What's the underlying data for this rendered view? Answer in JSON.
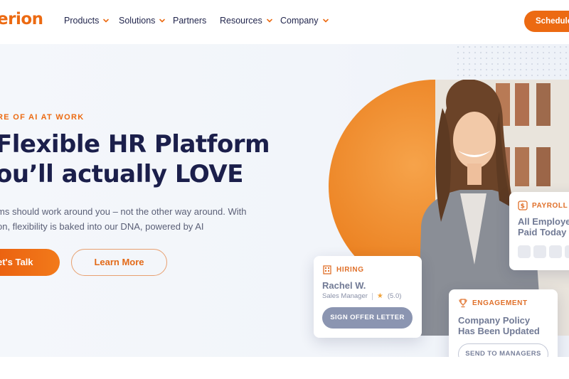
{
  "nav": {
    "logo": "erion",
    "items": [
      {
        "label": "Products",
        "has_dropdown": true
      },
      {
        "label": "Solutions",
        "has_dropdown": true
      },
      {
        "label": "Partners",
        "has_dropdown": false
      },
      {
        "label": "Resources",
        "has_dropdown": true
      },
      {
        "label": "Company",
        "has_dropdown": true
      }
    ],
    "cta": "Schedule"
  },
  "hero": {
    "eyebrow": "RE OF AI AT WORK",
    "headline_line1": "Flexible HR Platform",
    "headline_line2": "ou’ll actually LOVE",
    "sub_line1": "ms should work around you – not the other way around.  With",
    "sub_line2": "on, flexibility is baked into our DNA, powered by AI",
    "primary_button": "et's Talk",
    "secondary_button": "Learn More"
  },
  "cards": {
    "hiring": {
      "tag": "HIRING",
      "name": "Rachel W.",
      "role": "Sales Manager",
      "rating": "(5.0)",
      "button": "SIGN OFFER LETTER"
    },
    "payroll": {
      "tag": "PAYROLL",
      "title_line1": "All Employe",
      "title_line2": "Paid Today"
    },
    "engagement": {
      "tag": "ENGAGEMENT",
      "title_line1": "Company Policy",
      "title_line2": "Has Been Updated",
      "button": "SEND TO MANAGERS"
    }
  },
  "colors": {
    "brand_orange": "#ec6a12",
    "navy": "#1b1f4b",
    "muted_text": "#717a95"
  }
}
